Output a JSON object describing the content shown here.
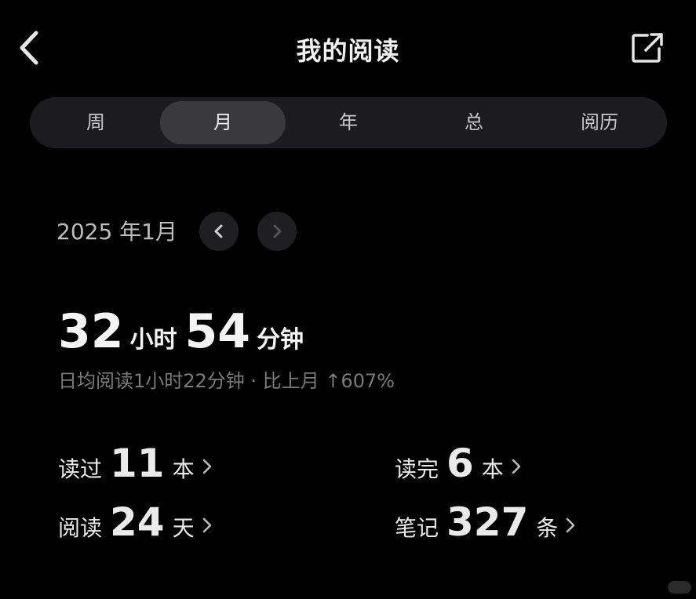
{
  "header": {
    "title": "我的阅读",
    "back_icon": "chevron-left-icon",
    "share_icon": "external-share-icon"
  },
  "tabs": [
    {
      "label": "周",
      "active": false
    },
    {
      "label": "月",
      "active": true
    },
    {
      "label": "年",
      "active": false
    },
    {
      "label": "总",
      "active": false
    },
    {
      "label": "阅历",
      "active": false
    }
  ],
  "period": {
    "label": "2025 年1月",
    "prev_icon": "chevron-left-icon",
    "next_icon": "chevron-right-icon"
  },
  "total": {
    "hours": "32",
    "hours_unit": "小时",
    "minutes": "54",
    "minutes_unit": "分钟"
  },
  "subline": "日均阅读1小时22分钟 · 比上月 ↑607%",
  "stats": [
    {
      "label": "读过",
      "value": "11",
      "unit": "本"
    },
    {
      "label": "读完",
      "value": "6",
      "unit": "本"
    },
    {
      "label": "阅读",
      "value": "24",
      "unit": "天"
    },
    {
      "label": "笔记",
      "value": "327",
      "unit": "条"
    }
  ],
  "colors": {
    "background": "#000000",
    "tab_bar": "#1c1c1e",
    "tab_active": "#3a3a3c",
    "text_primary": "#f0f0f0",
    "text_secondary": "#7a7a7a"
  }
}
